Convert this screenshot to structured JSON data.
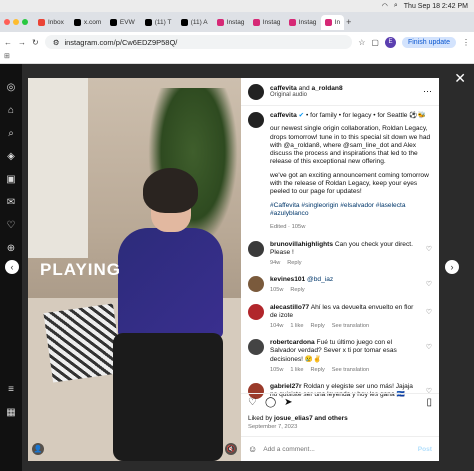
{
  "mac": {
    "clock": "Thu Sep 18  2:42 PM"
  },
  "tabs": [
    {
      "label": "Inbox",
      "color": "#ea4335"
    },
    {
      "label": "x.com",
      "color": "#000000"
    },
    {
      "label": "EVW",
      "color": "#000000"
    },
    {
      "label": "(11) T",
      "color": "#000000"
    },
    {
      "label": "(11) A",
      "color": "#000000"
    },
    {
      "label": "Instag",
      "color": "#d62976"
    },
    {
      "label": "Instag",
      "color": "#d62976"
    },
    {
      "label": "Instag",
      "color": "#d62976"
    },
    {
      "label": "In",
      "color": "#d62976"
    }
  ],
  "address": {
    "url": "instagram.com/p/Cw6EDZ9P58Q/",
    "finish_label": "Finish update",
    "profile_letter": "E"
  },
  "media": {
    "overlay_text": "PLAYING"
  },
  "post": {
    "author": "caffevita",
    "with": "a_roldan8",
    "and_word": "and",
    "audio": "Original audio",
    "caption_author": "caffevita",
    "caption_lines": [
      "• for family • for legacy • for Seattle ⚽🐝",
      "our newest single origin collaboration, Roldan Legacy, drops tomorrow! tune in to this special sit down we had with @a_roldan8, where @sam_line_dot and Alex discuss the process and inspirations that led to the release of this exceptional new offering.",
      "we've got an exciting announcement coming tomorrow with the release of Roldan Legacy, keep your eyes peeled to our page for updates!",
      "#Caffevita #singleorigin #elsalvador #laselecta #azulyblanco"
    ],
    "caption_meta": "Edited · 105w"
  },
  "comments": [
    {
      "user": "brunovillahighlights",
      "text": "Can you check your direct. Please !",
      "age": "94w",
      "likes": "",
      "reply": "Reply",
      "translate": "",
      "color": "#3a3a3a"
    },
    {
      "user": "kevines101",
      "text": "@bd_iaz",
      "age": "105w",
      "likes": "",
      "reply": "Reply",
      "translate": "",
      "color": "#7a5a3c"
    },
    {
      "user": "alecastillo77",
      "text": "Ahí les va devuelta envuelto en flor de izote",
      "age": "104w",
      "likes": "1 like",
      "reply": "Reply",
      "translate": "See translation",
      "color": "#b1262b"
    },
    {
      "user": "robertcardona",
      "text": "Fué tu último juego con el Salvador verdad? Sever x ti por tomar esas decisiones! 😢✌️",
      "age": "105w",
      "likes": "1 like",
      "reply": "Reply",
      "translate": "See translation",
      "color": "#444444"
    },
    {
      "user": "gabriel27r",
      "text": "Roldan y elegiste ser uno más! Jajaja no quisiste ser una leyenda y hoy les gana 🇸🇻",
      "age": "",
      "likes": "",
      "reply": "",
      "translate": "",
      "color": "#9a3a2a"
    }
  ],
  "footer": {
    "liked_by_prefix": "Liked by",
    "liked_by_user": "josue_elias7",
    "liked_by_suffix": "and others",
    "date": "September 7, 2023",
    "add_comment": "Add a comment...",
    "post_label": "Post"
  }
}
